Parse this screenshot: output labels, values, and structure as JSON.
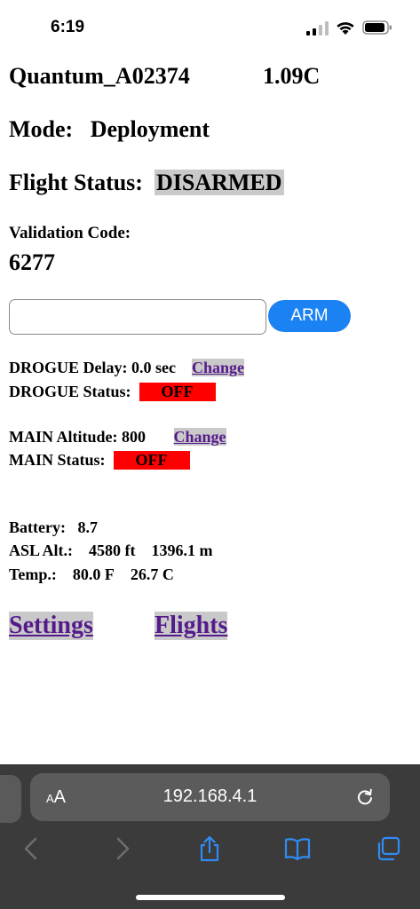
{
  "status_bar": {
    "time": "6:19"
  },
  "device": {
    "name": "Quantum_A02374",
    "version": "1.09C"
  },
  "mode": {
    "label": "Mode:",
    "value": "Deployment"
  },
  "flight_status": {
    "label": "Flight Status:",
    "value": "DISARMED"
  },
  "validation": {
    "label": "Validation Code:",
    "code": "6277"
  },
  "arm": {
    "input_value": "",
    "button_label": "ARM"
  },
  "drogue": {
    "delay_label": "DROGUE Delay: 0.0 sec",
    "change_label": "Change",
    "status_label": "DROGUE Status:",
    "status_value": "OFF"
  },
  "main": {
    "altitude_label": "MAIN Altitude: 800",
    "change_label": "Change",
    "status_label": "MAIN Status:",
    "status_value": "OFF"
  },
  "telemetry": {
    "battery_label": "Battery:",
    "battery_value": "8.7",
    "asl_label": "ASL Alt.:",
    "asl_ft": "4580 ft",
    "asl_m": "1396.1 m",
    "temp_label": "Temp.:",
    "temp_f": "80.0 F",
    "temp_c": "26.7 C"
  },
  "nav": {
    "settings": "Settings",
    "flights": "Flights"
  },
  "browser": {
    "aa_small": "A",
    "aa_big": "A",
    "url": "192.168.4.1"
  },
  "colors": {
    "accent": "#1b82f4",
    "off": "#ff0000",
    "highlight": "#c9c9c9",
    "link": "#551a8b"
  }
}
